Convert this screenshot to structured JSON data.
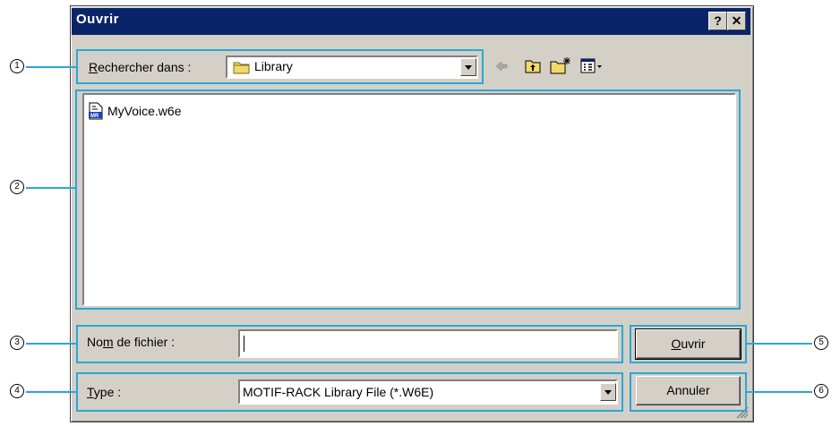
{
  "window": {
    "title": "Ouvrir",
    "help_glyph": "?",
    "close_glyph": "✕"
  },
  "look_in": {
    "label_u": "R",
    "label_rest": "echercher dans :",
    "value": "Library"
  },
  "toolbar": {
    "icons": [
      "back-arrow-icon",
      "up-folder-icon",
      "new-folder-icon",
      "view-menu-icon"
    ]
  },
  "files": [
    {
      "name": "MyVoice.w6e",
      "icon": "file-w6e-icon"
    }
  ],
  "filename": {
    "label_pre": "No",
    "label_u": "m",
    "label_rest": " de fichier :",
    "value": ""
  },
  "filetype": {
    "label_u": "T",
    "label_rest": "ype :",
    "value": "MOTIF-RACK Library File (*.W6E)"
  },
  "buttons": {
    "open_u": "O",
    "open_rest": "uvrir",
    "cancel": "Annuler"
  },
  "callouts": [
    "1",
    "2",
    "3",
    "4",
    "5",
    "6"
  ],
  "colors": {
    "callout": "#2aa7d6",
    "titlebar": "#0a246a",
    "dialog": "#d4d0c8"
  }
}
